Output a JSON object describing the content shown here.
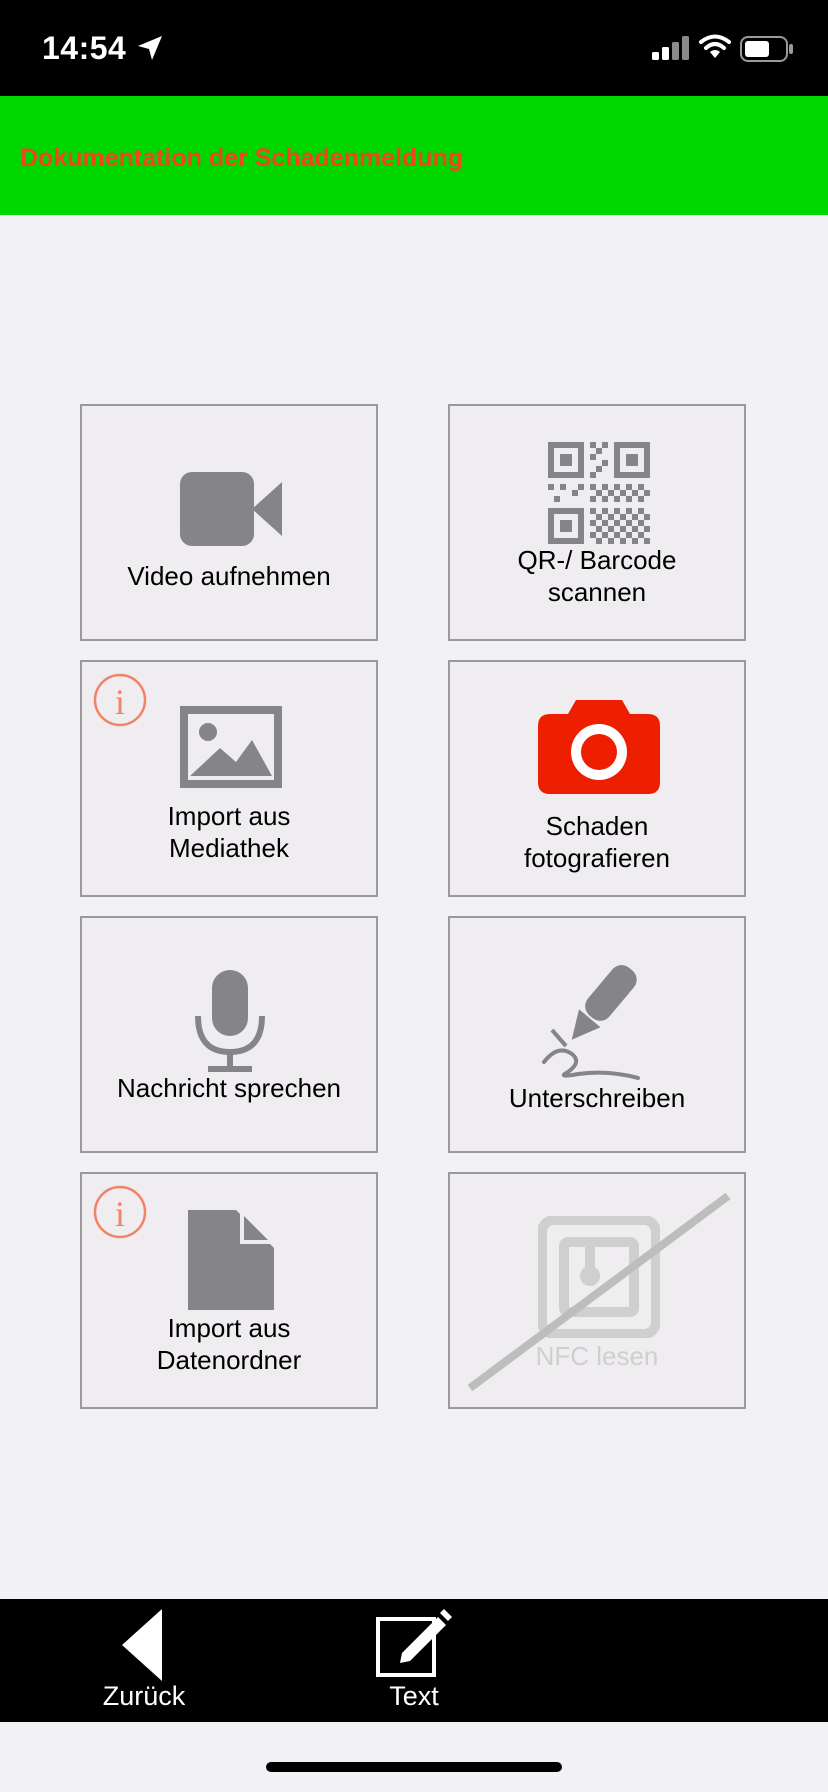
{
  "status_bar": {
    "time": "14:54"
  },
  "header": {
    "title": "Dokumentation der Schadenmeldung"
  },
  "tiles": {
    "video": {
      "label": "Video aufnehmen"
    },
    "qr": {
      "label_line1": "QR-/ Barcode",
      "label_line2": "scannen"
    },
    "import_media": {
      "label_line1": "Import aus",
      "label_line2": "Mediathek"
    },
    "photo": {
      "label_line1": "Schaden",
      "label_line2": "fotografieren"
    },
    "voice": {
      "label": "Nachricht sprechen"
    },
    "sign": {
      "label": "Unterschreiben"
    },
    "import_files": {
      "label_line1": "Import aus",
      "label_line2": "Datenordner"
    },
    "nfc": {
      "label": "NFC lesen"
    }
  },
  "bottom_nav": {
    "back_label": "Zurück",
    "text_label": "Text"
  },
  "colors": {
    "header_bg": "#00d600",
    "header_text": "#f0451f",
    "icon_gray": "#858487",
    "camera_red": "#ee1e00",
    "info_orange": "#f2826a"
  }
}
